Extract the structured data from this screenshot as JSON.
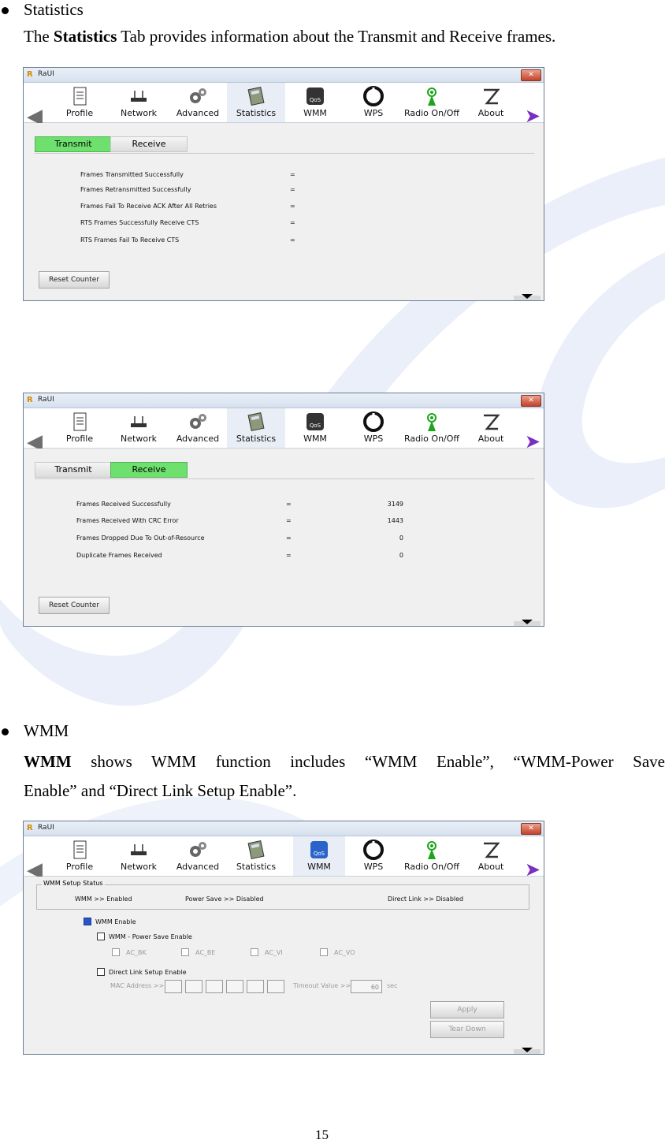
{
  "section_statistics": {
    "bullet": "Statistics",
    "para_pre": "The ",
    "para_bold": "Statistics",
    "para_post": " Tab provides information about the Transmit and Receive frames."
  },
  "section_wmm": {
    "bullet": "WMM",
    "para_bold": "WMM",
    "para_line1": " shows WMM function includes “WMM Enable”, “WMM-Power Save",
    "para_line2": "Enable” and “Direct Link Setup Enable”."
  },
  "window": {
    "title": "RaUI",
    "close": "✕",
    "logo": "R",
    "toolbar": [
      "Profile",
      "Network",
      "Advanced",
      "Statistics",
      "WMM",
      "WPS",
      "Radio On/Off",
      "About"
    ]
  },
  "transmit_screen": {
    "tabs": [
      "Transmit",
      "Receive"
    ],
    "active_tab": "Transmit",
    "rows": [
      {
        "label": "Frames Transmitted Successfully",
        "sep": "=",
        "value": ""
      },
      {
        "label": "Frames Retransmitted Successfully",
        "sep": "=",
        "value": ""
      },
      {
        "label": "Frames Fail To Receive ACK After All Retries",
        "sep": "=",
        "value": ""
      },
      {
        "label": "RTS Frames Successfully Receive CTS",
        "sep": "=",
        "value": ""
      },
      {
        "label": "RTS Frames Fail To Receive CTS",
        "sep": "=",
        "value": ""
      }
    ],
    "reset_button": "Reset Counter"
  },
  "receive_screen": {
    "tabs": [
      "Transmit",
      "Receive"
    ],
    "active_tab": "Receive",
    "rows": [
      {
        "label": "Frames Received Successfully",
        "sep": "=",
        "value": "3149"
      },
      {
        "label": "Frames Received With CRC Error",
        "sep": "=",
        "value": "1443"
      },
      {
        "label": "Frames Dropped Due To Out-of-Resource",
        "sep": "=",
        "value": "0"
      },
      {
        "label": "Duplicate Frames Received",
        "sep": "=",
        "value": "0"
      }
    ],
    "reset_button": "Reset Counter"
  },
  "wmm_screen": {
    "status_legend": "WMM Setup Status",
    "status_wmm": "WMM >> Enabled",
    "status_power": "Power Save >> Disabled",
    "status_dls": "Direct Link >> Disabled",
    "wmm_enable": "WMM Enable",
    "power_save_enable": "WMM - Power Save Enable",
    "ac": [
      "AC_BK",
      "AC_BE",
      "AC_VI",
      "AC_VO"
    ],
    "dls_enable": "Direct Link Setup Enable",
    "mac_label": "MAC Address >>",
    "timeout_label": "Timeout Value >>",
    "timeout_value": "60",
    "timeout_unit": "sec",
    "apply_button": "Apply",
    "teardown_button": "Tear Down"
  },
  "page_number": "15",
  "colors": {
    "active_tab": "#6ee06e",
    "wmm_check": "#2a55c9",
    "watermark": "#dfe6f6"
  }
}
